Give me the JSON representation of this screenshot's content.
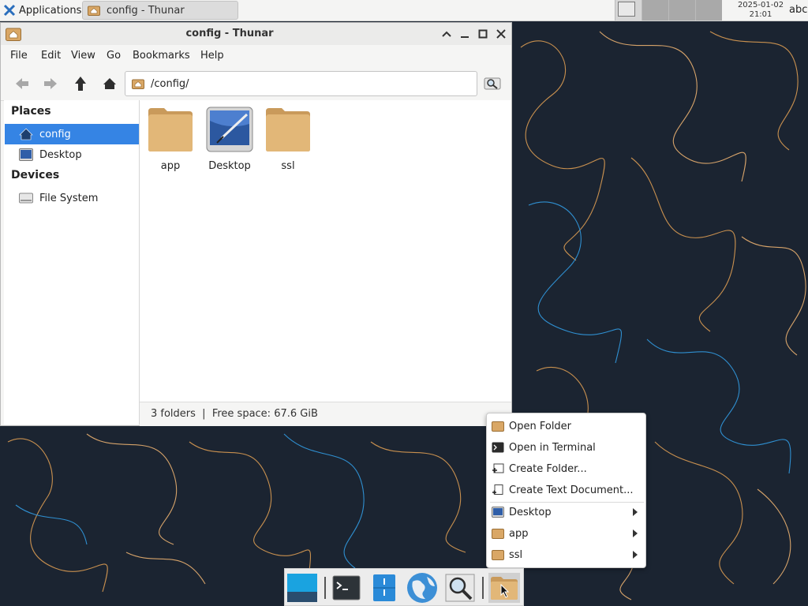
{
  "panel": {
    "applications_label": "Applications",
    "task_label": "config - Thunar",
    "clock_date": "2025-01-02",
    "clock_time": "21:01",
    "keyboard_layout": "abc"
  },
  "window": {
    "title": "config - Thunar",
    "menu": [
      "File",
      "Edit",
      "View",
      "Go",
      "Bookmarks",
      "Help"
    ],
    "location_path": "/config/",
    "sidebar": {
      "places_heading": "Places",
      "places": [
        {
          "label": "config",
          "icon": "home-folder-icon",
          "selected": true
        },
        {
          "label": "Desktop",
          "icon": "desktop-icon",
          "selected": false
        }
      ],
      "devices_heading": "Devices",
      "devices": [
        {
          "label": "File System",
          "icon": "drive-icon"
        }
      ]
    },
    "files": [
      {
        "name": "app",
        "icon": "folder-icon"
      },
      {
        "name": "Desktop",
        "icon": "desktop-folder-icon"
      },
      {
        "name": "ssl",
        "icon": "folder-icon"
      }
    ],
    "status": "3 folders  |  Free space: 67.6 GiB"
  },
  "context_menu": {
    "items": [
      {
        "label": "Open Folder",
        "icon": "folder-icon",
        "submenu": false
      },
      {
        "label": "Open in Terminal",
        "icon": "terminal-icon",
        "submenu": false
      },
      {
        "label": "Create Folder...",
        "icon": "new-folder-icon",
        "submenu": false
      },
      {
        "label": "Create Text Document...",
        "icon": "new-document-icon",
        "submenu": false
      },
      {
        "label": "Desktop",
        "icon": "desktop-icon",
        "submenu": true
      },
      {
        "label": "app",
        "icon": "folder-icon",
        "submenu": true
      },
      {
        "label": "ssl",
        "icon": "folder-icon",
        "submenu": true
      }
    ]
  },
  "dock": {
    "items": [
      "show-desktop-icon",
      "terminal-icon",
      "file-manager-icon",
      "web-browser-icon",
      "app-finder-icon",
      "home-folder-icon"
    ]
  },
  "colors": {
    "selection": "#3584e4",
    "wallpaper": "#1b2431",
    "wallpaper_line_orange": "#c8904f",
    "wallpaper_line_blue": "#2f8fd0"
  }
}
